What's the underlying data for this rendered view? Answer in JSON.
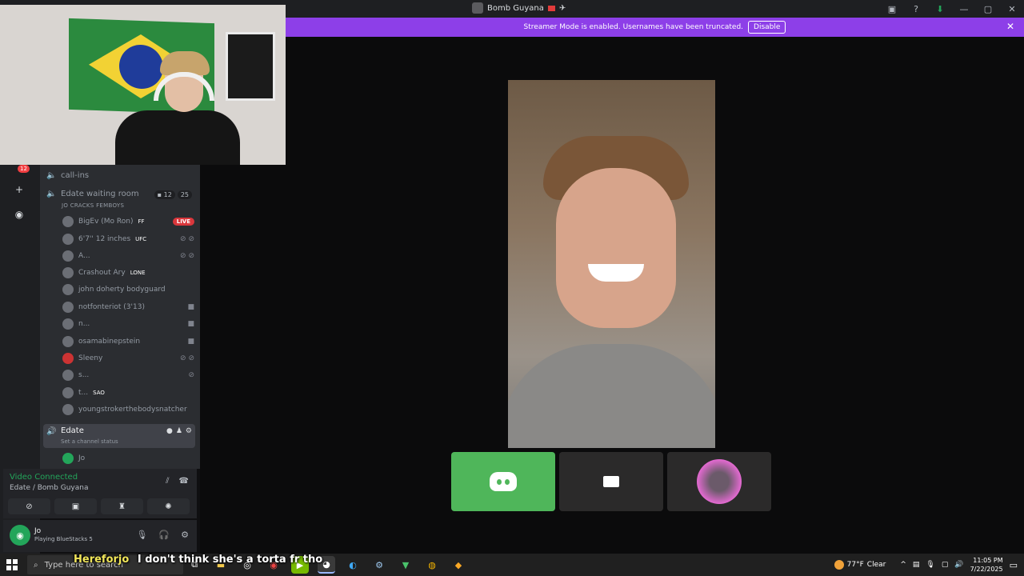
{
  "titlebar": {
    "title": "Bomb Guyana",
    "icons": [
      "guild-icon",
      "flag-icon",
      "airplane-icon",
      "screen-share-icon",
      "help-icon",
      "download-icon",
      "minimize-icon",
      "maximize-icon",
      "close-icon"
    ]
  },
  "banner": {
    "text": "Streamer Mode is enabled. Usernames have been truncated.",
    "button": "Disable",
    "color": "#8d3fe8"
  },
  "rail": {
    "badge": "12"
  },
  "channels": {
    "callins": "call-ins",
    "waiting_room": "Edate waiting room",
    "waiting_cam_count": "12",
    "waiting_count": "25",
    "waiting_status": "JO CRACKS FEMBOYS",
    "members": [
      {
        "name": "BigEv (Mo Ron)",
        "tag": "FF",
        "right": "LIVE"
      },
      {
        "name": "6'7'' 12 inches",
        "tag": "UFC",
        "right": "muted"
      },
      {
        "name": "A...",
        "tag": "",
        "right": "muted"
      },
      {
        "name": "Crashout Ary",
        "tag": "LONE",
        "right": ""
      },
      {
        "name": "john doherty bodyguard",
        "tag": "",
        "right": ""
      },
      {
        "name": "notfonteriot (3'13)",
        "tag": "",
        "right": "camera"
      },
      {
        "name": "n...",
        "tag": "",
        "right": "camera"
      },
      {
        "name": "osamabinepstein",
        "tag": "",
        "right": "camera"
      },
      {
        "name": "Sleeny",
        "tag": "",
        "right": "muted"
      },
      {
        "name": "s...",
        "tag": "",
        "right": "mic-off"
      },
      {
        "name": "t...",
        "tag": "SAO",
        "right": ""
      },
      {
        "name": "youngstrokerthebodysnatcher",
        "tag": "",
        "right": ""
      }
    ],
    "edate": "Edate",
    "edate_status": "Set a channel status",
    "edate_member": "Jo"
  },
  "voice": {
    "title": "Video Connected",
    "subtitle": "Edate / Bomb Guyana"
  },
  "user": {
    "name": "Jo",
    "activity": "Playing BlueStacks 5"
  },
  "taskbar": {
    "search_placeholder": "Type here to search",
    "weather": "77°F",
    "weather_label": "Clear",
    "time": "11:05 PM",
    "date": "7/22/2025"
  },
  "caption": {
    "speaker": "Hereforjo",
    "text": "I don't think she's a torta fr tho"
  }
}
